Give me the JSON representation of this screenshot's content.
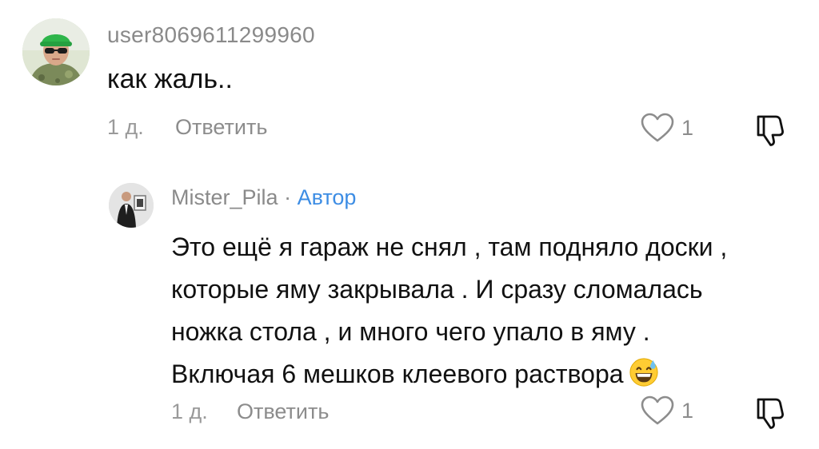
{
  "comment": {
    "username": "user8069611299960",
    "text": "как жаль..",
    "time": "1 д.",
    "reply_label": "Ответить",
    "like_count": "1"
  },
  "reply": {
    "username": "Mister_Pila",
    "separator": "·",
    "author_badge": "Автор",
    "lines": [
      "Это ещё я гараж не снял , там подняло доски ,",
      "которые яму закрывала . И сразу сломалась",
      "ножка стола , и много чего упало в яму .",
      "Включая 6 мешков клеевого раствора"
    ],
    "time": "1 д.",
    "reply_label": "Ответить",
    "like_count": "1"
  },
  "icons": {
    "like": "heart-outline-icon",
    "dislike": "thumbs-down-icon",
    "emoji": "grinning-sweat-emoji"
  },
  "colors": {
    "author_badge": "#3d8de4",
    "muted": "#8c8c8c",
    "text": "#111111"
  }
}
